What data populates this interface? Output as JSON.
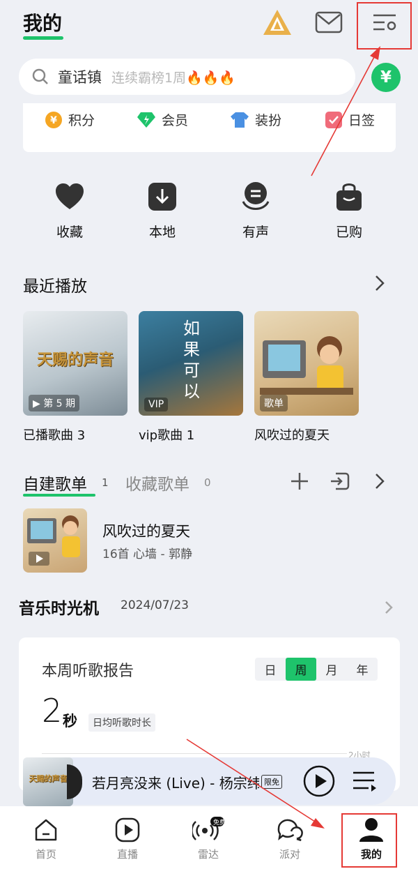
{
  "header": {
    "title": "我的"
  },
  "search": {
    "keyword": "童话镇",
    "hint": "连续霸榜1周🔥🔥🔥"
  },
  "coin_label": "¥",
  "quick": [
    {
      "label": "积分",
      "icon": "points-icon"
    },
    {
      "label": "会员",
      "icon": "vip-diamond-icon"
    },
    {
      "label": "装扮",
      "icon": "shirt-icon"
    },
    {
      "label": "日签",
      "icon": "checkin-icon"
    }
  ],
  "shortcuts": [
    {
      "label": "收藏",
      "icon": "heart-icon"
    },
    {
      "label": "本地",
      "icon": "download-icon"
    },
    {
      "label": "有声",
      "icon": "audiobook-icon"
    },
    {
      "label": "已购",
      "icon": "bag-icon"
    }
  ],
  "recent": {
    "title": "最近播放",
    "items": [
      {
        "caption": "已播歌曲 3",
        "badge": "▶ 第 5 期",
        "cover_text": "天赐的声音"
      },
      {
        "caption": "vip歌曲 1",
        "badge": "VIP",
        "cover_text": "如果可以"
      },
      {
        "caption": "风吹过的夏天",
        "badge": "歌单",
        "cover_text": ""
      }
    ]
  },
  "playlists": {
    "tab_own": "自建歌单",
    "tab_own_count": "1",
    "tab_fav": "收藏歌单",
    "tab_fav_count": "0",
    "item": {
      "name": "风吹过的夏天",
      "meta": "16首 心墙 - 郭静"
    }
  },
  "time_machine": {
    "title": "音乐时光机",
    "date": "2024/07/23"
  },
  "report": {
    "title": "本周听歌报告",
    "segments": [
      "日",
      "周",
      "月",
      "年"
    ],
    "active_segment": "周",
    "value": "2",
    "unit": "秒",
    "tag": "日均听歌时长",
    "axis_label": "2小时"
  },
  "player": {
    "title": "若月亮没来 (Live) - 杨宗纬",
    "tag": "限免",
    "cover_text": "天赐的声音"
  },
  "nav": [
    {
      "label": "首页",
      "icon": "home-icon"
    },
    {
      "label": "直播",
      "icon": "live-play-icon"
    },
    {
      "label": "雷达",
      "icon": "radar-icon",
      "badge": "免费"
    },
    {
      "label": "派对",
      "icon": "party-chat-icon"
    },
    {
      "label": "我的",
      "icon": "profile-icon"
    }
  ],
  "colors": {
    "accent": "#1ec36b",
    "highlight": "#e53935"
  }
}
